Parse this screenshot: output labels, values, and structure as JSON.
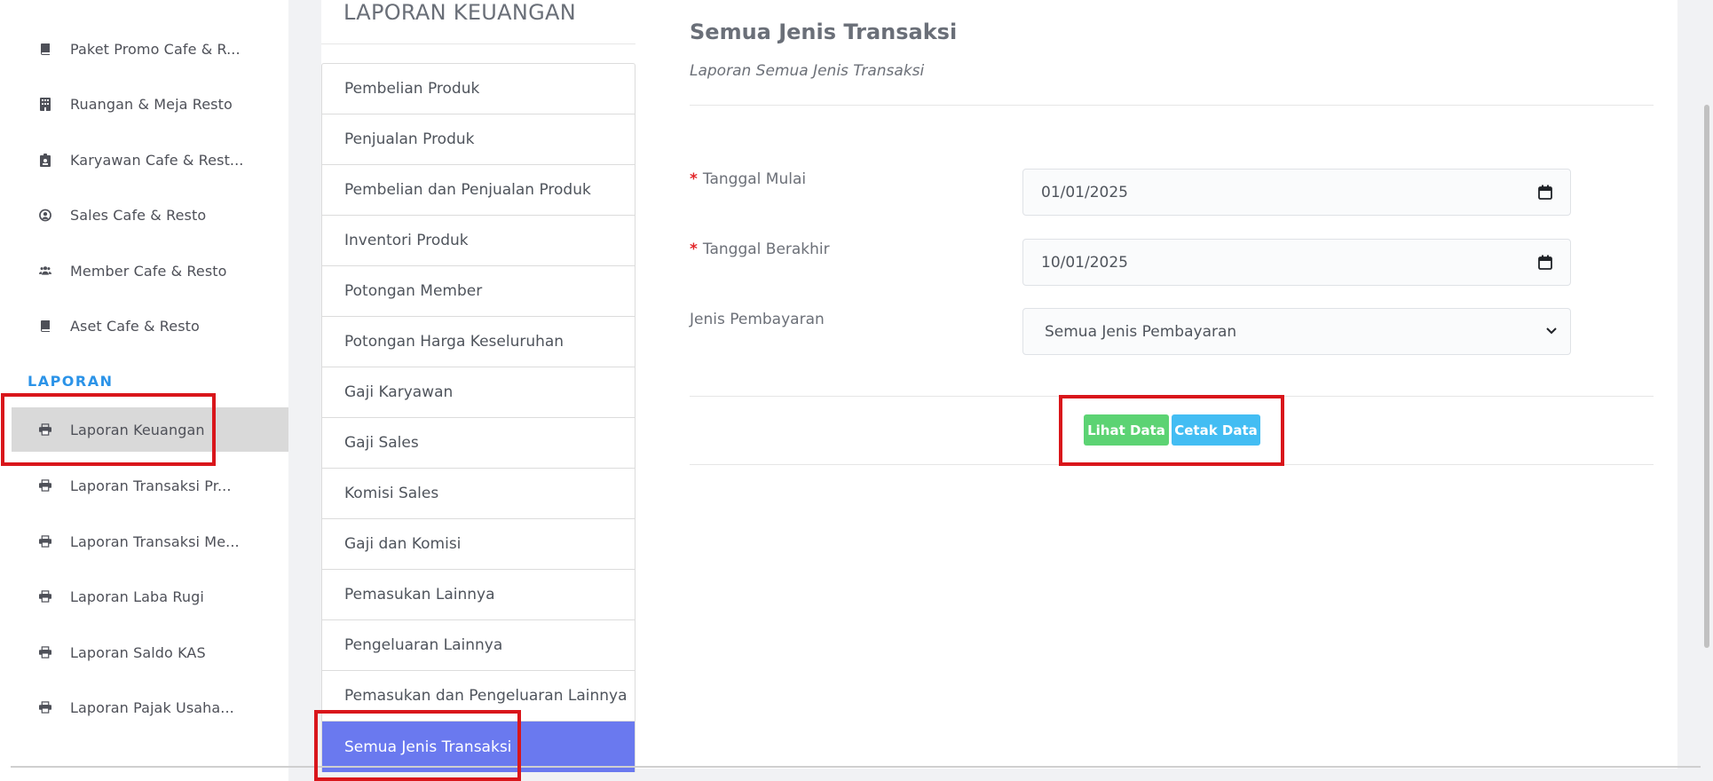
{
  "sidebar": {
    "items": [
      {
        "label": "Paket Promo Cafe & R...",
        "icon": "book-icon"
      },
      {
        "label": "Ruangan & Meja Resto",
        "icon": "building-icon"
      },
      {
        "label": "Karyawan Cafe & Rest...",
        "icon": "id-badge-icon"
      },
      {
        "label": "Sales Cafe & Resto",
        "icon": "user-circle-icon"
      },
      {
        "label": "Member Cafe & Resto",
        "icon": "users-icon"
      },
      {
        "label": "Aset Cafe & Resto",
        "icon": "book-icon"
      }
    ],
    "section_title": "LAPORAN",
    "report_items": [
      {
        "label": "Laporan Keuangan",
        "icon": "printer-icon",
        "active": true
      },
      {
        "label": "Laporan Transaksi Pr...",
        "icon": "printer-icon"
      },
      {
        "label": "Laporan Transaksi Me...",
        "icon": "printer-icon"
      },
      {
        "label": "Laporan Laba Rugi",
        "icon": "printer-icon"
      },
      {
        "label": "Laporan Saldo KAS",
        "icon": "printer-icon"
      },
      {
        "label": "Laporan Pajak Usaha...",
        "icon": "printer-icon"
      }
    ]
  },
  "report_menu": {
    "title": "LAPORAN KEUANGAN",
    "items": [
      "Pembelian Produk",
      "Penjualan Produk",
      "Pembelian dan Penjualan Produk",
      "Inventori Produk",
      "Potongan Member",
      "Potongan Harga Keseluruhan",
      "Gaji Karyawan",
      "Gaji Sales",
      "Komisi Sales",
      "Gaji dan Komisi",
      "Pemasukan Lainnya",
      "Pengeluaran Lainnya",
      "Pemasukan dan Pengeluaran Lainnya",
      "Semua Jenis Transaksi"
    ],
    "active_item": "Semua Jenis Transaksi"
  },
  "main": {
    "title": "Semua Jenis Transaksi",
    "subtitle": "Laporan Semua Jenis Transaksi",
    "form": {
      "start_date_label": "Tanggal Mulai",
      "start_date_value": "01/01/2025",
      "end_date_label": "Tanggal Berakhir",
      "end_date_value": "10/01/2025",
      "payment_label": "Jenis Pembayaran",
      "payment_value": "Semua Jenis Pembayaran",
      "required_mark": "*"
    },
    "buttons": {
      "view": "Lihat Data",
      "print": "Cetak Data"
    }
  },
  "colors": {
    "accent_blue": "#2b93e8",
    "menu_active": "#6a79ef",
    "btn_green": "#5cd373",
    "btn_blue": "#43bdf3",
    "highlight_red": "#d9161b"
  }
}
